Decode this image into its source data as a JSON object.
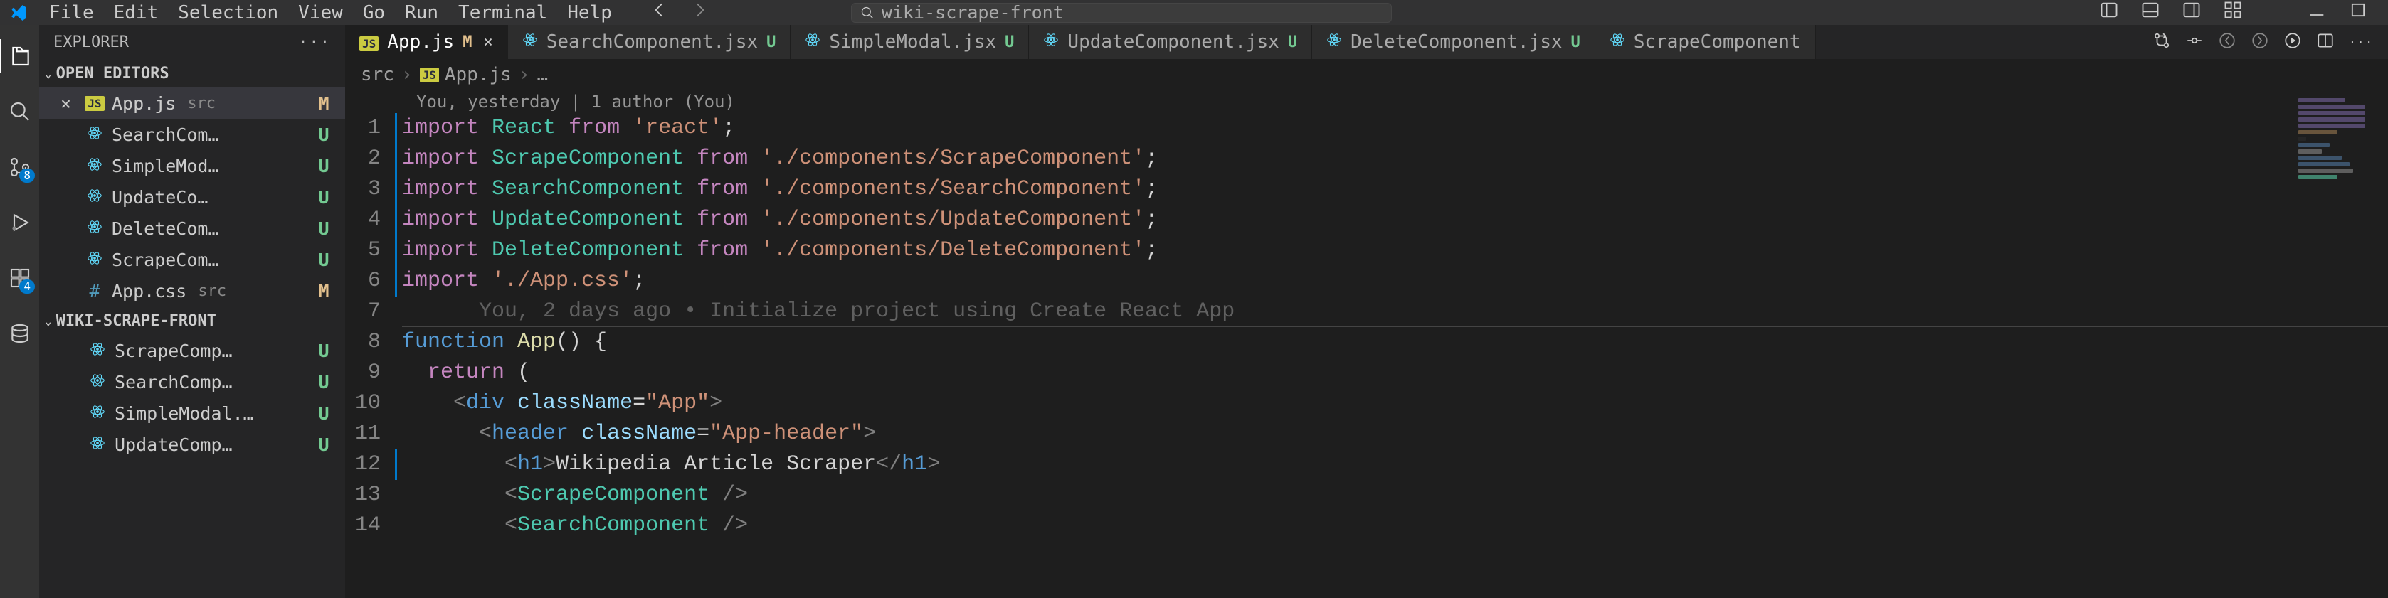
{
  "menubar": {
    "items": [
      "File",
      "Edit",
      "Selection",
      "View",
      "Go",
      "Run",
      "Terminal",
      "Help"
    ],
    "search_text": "wiki-scrape-front"
  },
  "activitybar": {
    "source_control_badge": "8",
    "extensions_badge": "4"
  },
  "sidebar": {
    "title": "EXPLORER",
    "open_editors_label": "OPEN EDITORS",
    "open_editors": [
      {
        "name": "App.js",
        "dir": "src",
        "status": "M",
        "icon": "js",
        "active": true,
        "closeable": true
      },
      {
        "name": "SearchCom…",
        "dir": "",
        "status": "U",
        "icon": "react"
      },
      {
        "name": "SimpleMod…",
        "dir": "",
        "status": "U",
        "icon": "react"
      },
      {
        "name": "UpdateCo…",
        "dir": "",
        "status": "U",
        "icon": "react"
      },
      {
        "name": "DeleteCom…",
        "dir": "",
        "status": "U",
        "icon": "react"
      },
      {
        "name": "ScrapeCom…",
        "dir": "",
        "status": "U",
        "icon": "react"
      },
      {
        "name": "App.css",
        "dir": "src",
        "status": "M",
        "icon": "css"
      }
    ],
    "folder_label": "WIKI-SCRAPE-FRONT",
    "folder_items": [
      {
        "name": "ScrapeComp…",
        "status": "U",
        "icon": "react"
      },
      {
        "name": "SearchComp…",
        "status": "U",
        "icon": "react"
      },
      {
        "name": "SimpleModal.…",
        "status": "U",
        "icon": "react"
      },
      {
        "name": "UpdateComp…",
        "status": "U",
        "icon": "react"
      }
    ]
  },
  "tabs": [
    {
      "name": "App.js",
      "status": "M",
      "icon": "js",
      "active": true,
      "closeable": true
    },
    {
      "name": "SearchComponent.jsx",
      "status": "U",
      "icon": "react"
    },
    {
      "name": "SimpleModal.jsx",
      "status": "U",
      "icon": "react"
    },
    {
      "name": "UpdateComponent.jsx",
      "status": "U",
      "icon": "react"
    },
    {
      "name": "DeleteComponent.jsx",
      "status": "U",
      "icon": "react"
    },
    {
      "name": "ScrapeComponent",
      "status": "",
      "icon": "react"
    }
  ],
  "breadcrumbs": {
    "parts": [
      "src",
      "App.js"
    ],
    "tail": "…"
  },
  "codelens": "You, yesterday | 1 author (You)",
  "inline_blame": "You, 2 days ago • Initialize project using Create React App",
  "code": {
    "line_numbers": [
      "1",
      "2",
      "3",
      "4",
      "5",
      "6",
      "7",
      "8",
      "9",
      "10",
      "11",
      "12",
      "13",
      "14"
    ],
    "current_line": 7,
    "modified_gutter": [
      1,
      2,
      3,
      4,
      5,
      6,
      12
    ],
    "tokens": {
      "l1": [
        [
          "keyword",
          "import "
        ],
        [
          "module",
          "React "
        ],
        [
          "from",
          "from "
        ],
        [
          "string",
          "'react'"
        ],
        [
          "punct",
          ";"
        ]
      ],
      "l2": [
        [
          "keyword",
          "import "
        ],
        [
          "module",
          "ScrapeComponent "
        ],
        [
          "from",
          "from "
        ],
        [
          "string",
          "'./components/ScrapeComponent'"
        ],
        [
          "punct",
          ";"
        ]
      ],
      "l3": [
        [
          "keyword",
          "import "
        ],
        [
          "module",
          "SearchComponent "
        ],
        [
          "from",
          "from "
        ],
        [
          "string",
          "'./components/SearchComponent'"
        ],
        [
          "punct",
          ";"
        ]
      ],
      "l4": [
        [
          "keyword",
          "import "
        ],
        [
          "module",
          "UpdateComponent "
        ],
        [
          "from",
          "from "
        ],
        [
          "string",
          "'./components/UpdateComponent'"
        ],
        [
          "punct",
          ";"
        ]
      ],
      "l5": [
        [
          "keyword",
          "import "
        ],
        [
          "module",
          "DeleteComponent "
        ],
        [
          "from",
          "from "
        ],
        [
          "string",
          "'./components/DeleteComponent'"
        ],
        [
          "punct",
          ";"
        ]
      ],
      "l6": [
        [
          "keyword",
          "import "
        ],
        [
          "string",
          "'./App.css'"
        ],
        [
          "punct",
          ";"
        ]
      ],
      "l7": [],
      "l8": [
        [
          "func",
          "function "
        ],
        [
          "name",
          "App"
        ],
        [
          "punct",
          "() {"
        ]
      ],
      "l9": [
        [
          "text",
          "  "
        ],
        [
          "keyword",
          "return"
        ],
        [
          "punct",
          " ("
        ]
      ],
      "l10": [
        [
          "text",
          "    "
        ],
        [
          "angle",
          "<"
        ],
        [
          "tag",
          "div "
        ],
        [
          "attr",
          "className"
        ],
        [
          "punct",
          "="
        ],
        [
          "string",
          "\"App\""
        ],
        [
          "angle",
          ">"
        ]
      ],
      "l11": [
        [
          "text",
          "      "
        ],
        [
          "angle",
          "<"
        ],
        [
          "tag",
          "header "
        ],
        [
          "attr",
          "className"
        ],
        [
          "punct",
          "="
        ],
        [
          "string",
          "\"App-header\""
        ],
        [
          "angle",
          ">"
        ]
      ],
      "l12": [
        [
          "text",
          "        "
        ],
        [
          "angle",
          "<"
        ],
        [
          "tag",
          "h1"
        ],
        [
          "angle",
          ">"
        ],
        [
          "text",
          "Wikipedia Article Scraper"
        ],
        [
          "angle",
          "</"
        ],
        [
          "tag",
          "h1"
        ],
        [
          "angle",
          ">"
        ]
      ],
      "l13": [
        [
          "text",
          "        "
        ],
        [
          "angle",
          "<"
        ],
        [
          "module",
          "ScrapeComponent "
        ],
        [
          "angle",
          "/>"
        ]
      ],
      "l14": [
        [
          "text",
          "        "
        ],
        [
          "angle",
          "<"
        ],
        [
          "module",
          "SearchComponent "
        ],
        [
          "angle",
          "/>"
        ]
      ]
    }
  }
}
